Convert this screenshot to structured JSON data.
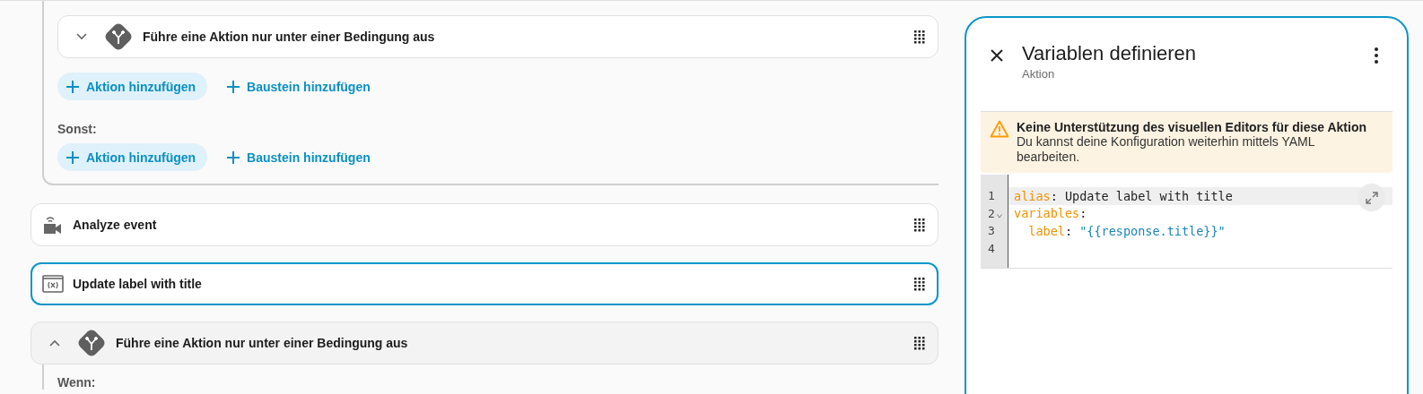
{
  "nested_block": {
    "actions": [
      {
        "kind": "condition",
        "title": "Führe eine Aktion nur unter einer Bedingung aus",
        "selected": false,
        "expanded": false
      }
    ],
    "then_buttons": [
      {
        "kind": "filled",
        "label": "Aktion hinzufügen"
      },
      {
        "kind": "text",
        "label": "Baustein hinzufügen"
      }
    ],
    "else_label": "Sonst:",
    "else_buttons": [
      {
        "kind": "filled",
        "label": "Aktion hinzufügen"
      },
      {
        "kind": "text",
        "label": "Baustein hinzufügen"
      }
    ]
  },
  "actions": [
    {
      "kind": "camera",
      "title": "Analyze event",
      "selected": false
    },
    {
      "kind": "variables",
      "title": "Update label with title",
      "selected": true
    },
    {
      "kind": "condition",
      "title": "Führe eine Aktion nur unter einer Bedingung aus",
      "selected": false,
      "expanded": true,
      "section_label": "Wenn:"
    }
  ],
  "panel": {
    "title": "Variablen definieren",
    "subtitle": "Aktion",
    "alert": {
      "title": "Keine Unterstützung des visuellen Editors für diese Aktion",
      "text": "Du kannst deine Konfiguration weiterhin mittels YAML bearbeiten."
    },
    "editor": {
      "lines": [
        {
          "number": "1",
          "active": true,
          "foldable": false,
          "tokens": [
            {
              "kind": "key",
              "text": "alias"
            },
            {
              "kind": "plain",
              "text": ": Update label with title"
            }
          ]
        },
        {
          "number": "2",
          "active": false,
          "foldable": true,
          "tokens": [
            {
              "kind": "key",
              "text": "variables"
            },
            {
              "kind": "plain",
              "text": ":"
            }
          ]
        },
        {
          "number": "3",
          "active": false,
          "foldable": false,
          "tokens": [
            {
              "kind": "key",
              "text": "  label"
            },
            {
              "kind": "plain",
              "text": ": "
            },
            {
              "kind": "string",
              "text": "\"{{response.title}}\""
            }
          ]
        },
        {
          "number": "4",
          "active": false,
          "foldable": false
        }
      ]
    }
  }
}
